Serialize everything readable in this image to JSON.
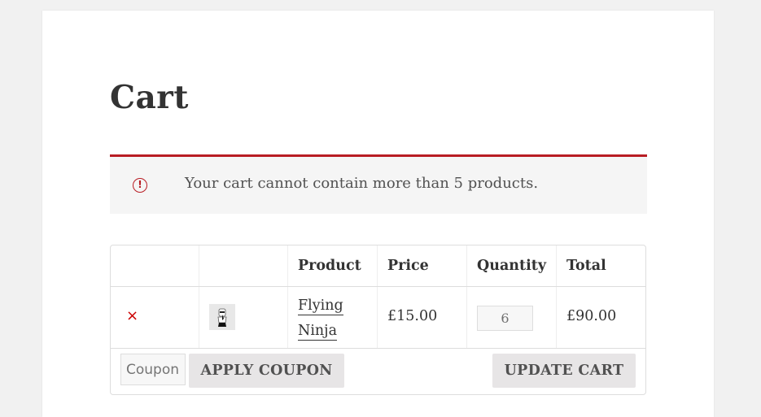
{
  "page": {
    "title": "Cart"
  },
  "notice": {
    "icon": "error-icon",
    "icon_glyph": "!",
    "message": "Your cart cannot contain more than 5 products.",
    "accent_color": "#b81c23"
  },
  "cart_table": {
    "columns": [
      "",
      "",
      "Product",
      "Price",
      "Quantity",
      "Total"
    ],
    "items": [
      {
        "remove_glyph": "×",
        "thumbnail": "flying-ninja-thumbnail",
        "product": "Flying Ninja",
        "price": "£15.00",
        "quantity": "6",
        "total": "£90.00"
      }
    ]
  },
  "actions": {
    "coupon_placeholder": "Coupon code",
    "apply_coupon_label": "APPLY COUPON",
    "update_cart_label": "UPDATE CART"
  }
}
